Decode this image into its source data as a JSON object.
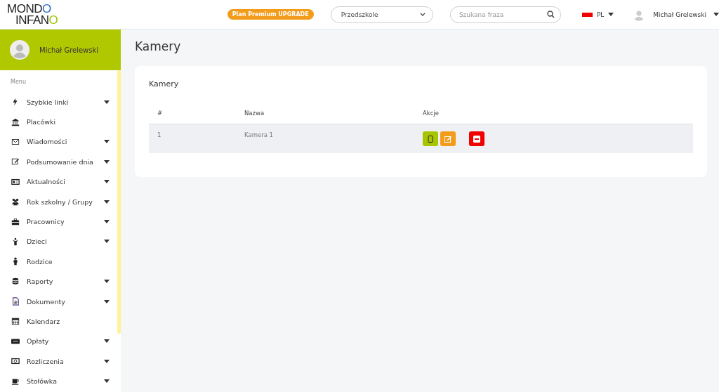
{
  "logo": {
    "line_1": "MONDO",
    "line_2": "INFANO"
  },
  "header": {
    "upgrade_badge": "Plan Premium UPGRADE",
    "facility_select": {
      "value": "Przedszkole"
    },
    "search": {
      "placeholder": "Szukana fraza"
    },
    "language": "PL",
    "user": "Michał Grelewski"
  },
  "sidebar": {
    "user": "Michał Grelewski",
    "menu_label": "Menu",
    "items": [
      {
        "label": "Szybkie linki",
        "expandable": true
      },
      {
        "label": "Placówki",
        "expandable": false
      },
      {
        "label": "Wiadomości",
        "expandable": true
      },
      {
        "label": "Podsumowanie dnia",
        "expandable": true
      },
      {
        "label": "Aktualności",
        "expandable": true
      },
      {
        "label": "Rok szkolny / Grupy",
        "expandable": true
      },
      {
        "label": "Pracownicy",
        "expandable": true
      },
      {
        "label": "Dzieci",
        "expandable": true
      },
      {
        "label": "Rodzice",
        "expandable": false
      },
      {
        "label": "Raporty",
        "expandable": true
      },
      {
        "label": "Dokumenty",
        "expandable": true
      },
      {
        "label": "Kalendarz",
        "expandable": false
      },
      {
        "label": "Opłaty",
        "expandable": true
      },
      {
        "label": "Rozliczenia",
        "expandable": true
      },
      {
        "label": "Stołówka",
        "expandable": true
      }
    ]
  },
  "page_title": "Kamery",
  "card": {
    "title": "Kamery",
    "table": {
      "columns": [
        "#",
        "Nazwa",
        "Akcje"
      ],
      "rows": [
        {
          "number": "1",
          "name": "Kamera 1",
          "actions": [
            {
              "kind": "view"
            },
            {
              "kind": "edit"
            },
            {
              "kind": "delete"
            }
          ]
        }
      ]
    }
  }
}
